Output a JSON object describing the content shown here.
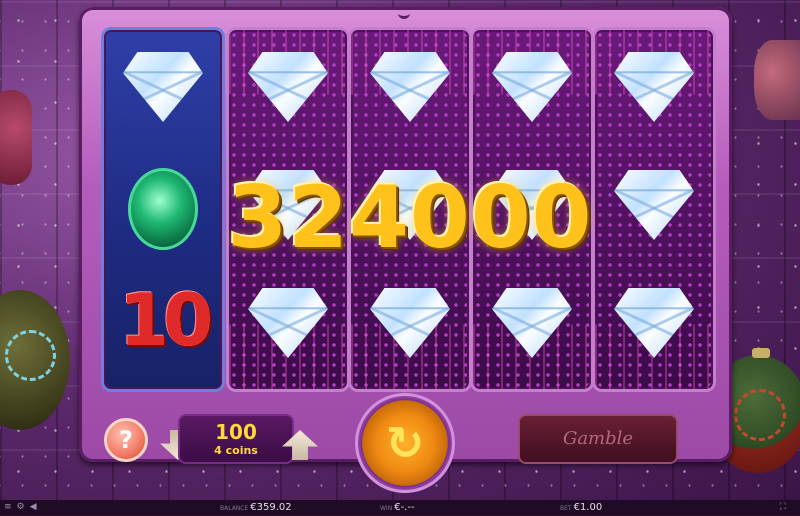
{
  "win_amount": "324000",
  "reels": [
    {
      "id": 1,
      "type": "special",
      "symbols": [
        "diamond",
        "emerald",
        "ten"
      ]
    },
    {
      "id": 2,
      "symbols": [
        "diamond",
        "diamond",
        "diamond"
      ]
    },
    {
      "id": 3,
      "symbols": [
        "diamond",
        "diamond",
        "diamond"
      ]
    },
    {
      "id": 4,
      "symbols": [
        "diamond",
        "diamond",
        "diamond"
      ]
    },
    {
      "id": 5,
      "symbols": [
        "diamond",
        "diamond",
        "diamond"
      ]
    }
  ],
  "symbol_text": {
    "ten": "10"
  },
  "controls": {
    "help_label": "?",
    "coins_value": "100",
    "coins_subtitle": "4 coins",
    "gamble_label": "Gamble",
    "spin_icon": "↻"
  },
  "status": {
    "balance_label": "BALANCE",
    "balance_value": "€359.02",
    "win_label": "WIN",
    "win_value": "€-.--",
    "bet_label": "BET",
    "bet_value": "€1.00"
  },
  "icons": {
    "menu": "menu-icon",
    "settings": "gear-icon",
    "sound": "speaker-icon",
    "fullscreen": "fullscreen-icon"
  },
  "colors": {
    "win_gold": "#ffc21a",
    "frame_pink": "#b45cbc",
    "special_reel_blue": "#2f3fa8",
    "help_orange": "#f37a64"
  }
}
